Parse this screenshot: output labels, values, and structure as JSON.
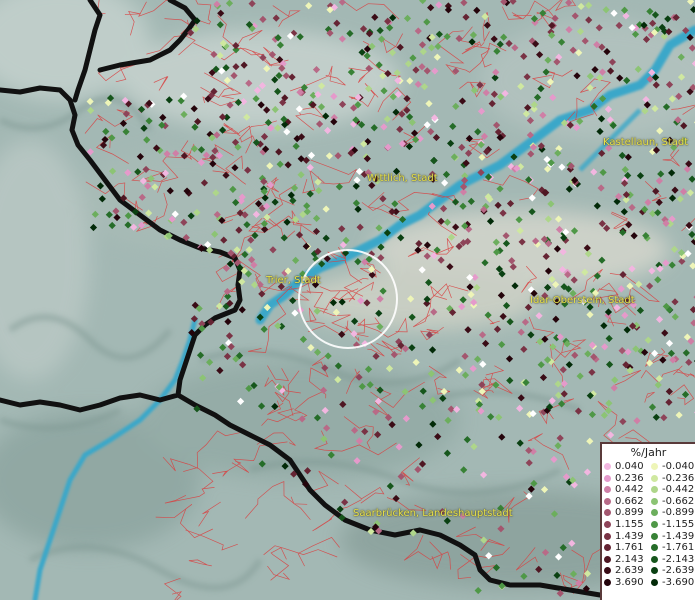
{
  "cities": [
    {
      "id": "wittlich",
      "label": "Wittlich, Stadt"
    },
    {
      "id": "kastellaun",
      "label": "Kastellaun, Stadt"
    },
    {
      "id": "trier",
      "label": "Trier, Stadt"
    },
    {
      "id": "idar",
      "label": "Idar-Oberstein, Stadt"
    },
    {
      "id": "saarbruecken",
      "label": "Saarbrücken, Landeshauptstadt"
    }
  ],
  "legend": {
    "title": "%/Jahr",
    "positive": [
      {
        "label": "0.040",
        "color": "#f2b6e0"
      },
      {
        "label": "0.236",
        "color": "#e59acb"
      },
      {
        "label": "0.442",
        "color": "#cf7fa6"
      },
      {
        "label": "0.662",
        "color": "#b86a87"
      },
      {
        "label": "0.899",
        "color": "#a3566e"
      },
      {
        "label": "1.155",
        "color": "#8e4459"
      },
      {
        "label": "1.439",
        "color": "#7a3345"
      },
      {
        "label": "1.761",
        "color": "#652433"
      },
      {
        "label": "2.143",
        "color": "#4f1723"
      },
      {
        "label": "2.639",
        "color": "#3a0c16"
      },
      {
        "label": "3.690",
        "color": "#24040b"
      }
    ],
    "negative": [
      {
        "label": "-0.040",
        "color": "#eef5b8"
      },
      {
        "label": "-0.236",
        "color": "#cfe8a0"
      },
      {
        "label": "-0.442",
        "color": "#aed68a"
      },
      {
        "label": "-0.662",
        "color": "#8cc474"
      },
      {
        "label": "-0.899",
        "color": "#6cae5d"
      },
      {
        "label": "-1.155",
        "color": "#4f9847"
      },
      {
        "label": "-1.439",
        "color": "#388236"
      },
      {
        "label": "-1.761",
        "color": "#256c28"
      },
      {
        "label": "-2.143",
        "color": "#16561c"
      },
      {
        "label": "-2.639",
        "color": "#0a4012"
      },
      {
        "label": "-3.690",
        "color": "#022a08"
      }
    ],
    "extra_colors": [
      "#ffffff"
    ]
  },
  "colors": {
    "terrain": "#9fb6b2",
    "river": "#3aa7c9",
    "border": "#111111",
    "municipal_lines": "#d94040",
    "highlight_circle": "#ffffff"
  }
}
